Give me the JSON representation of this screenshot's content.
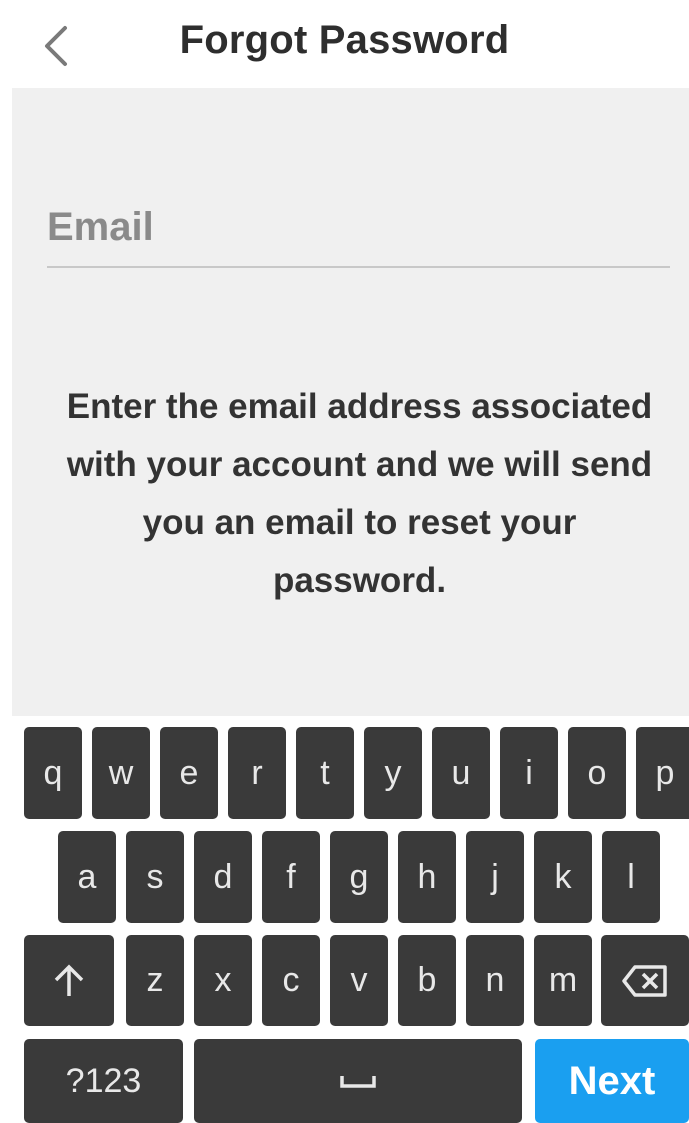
{
  "header": {
    "title": "Forgot Password",
    "back_icon": "chevron-left-icon"
  },
  "form": {
    "email_placeholder": "Email",
    "email_value": "",
    "instructions": "Enter the email address associated with your account and we will send you an email to reset your password."
  },
  "keyboard": {
    "row1": [
      "q",
      "w",
      "e",
      "r",
      "t",
      "y",
      "u",
      "i",
      "o",
      "p"
    ],
    "row2": [
      "a",
      "s",
      "d",
      "f",
      "g",
      "h",
      "j",
      "k",
      "l"
    ],
    "row3": [
      "z",
      "x",
      "c",
      "v",
      "b",
      "n",
      "m"
    ],
    "shift_icon": "shift-arrow-icon",
    "backspace_icon": "backspace-icon",
    "symbols_label": "?123",
    "space_icon": "space-icon",
    "next_label": "Next"
  },
  "colors": {
    "content_bg": "#f0f0f0",
    "key_bg": "#3a3a3a",
    "next_key_bg": "#1a9ff0"
  }
}
